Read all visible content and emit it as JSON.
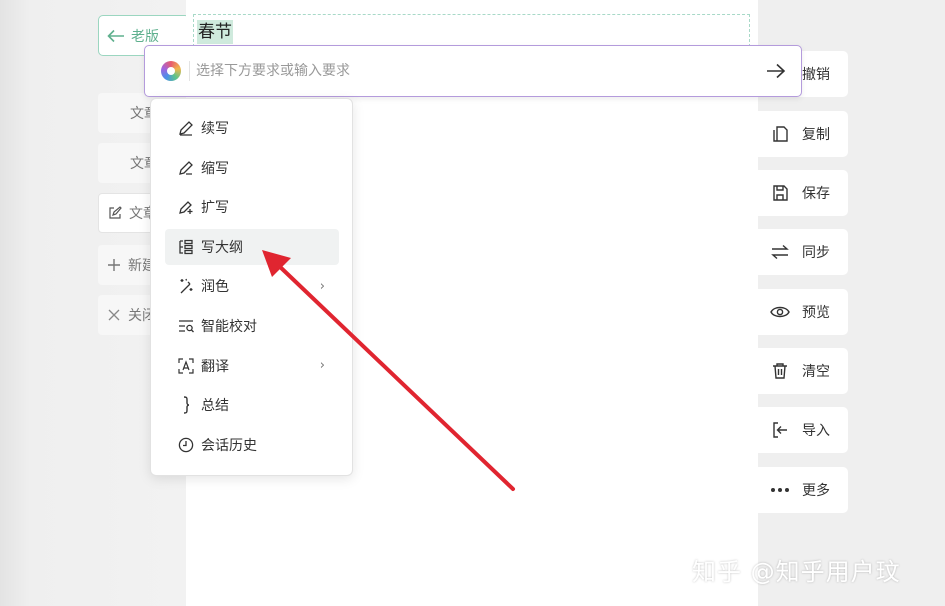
{
  "header": {
    "old_version_label": "老版"
  },
  "left_panel": {
    "items": [
      {
        "label": "文章"
      },
      {
        "label": "文章"
      },
      {
        "label": "文章"
      },
      {
        "label": "新建"
      },
      {
        "label": "关闭"
      }
    ]
  },
  "document": {
    "selected_text": "春节"
  },
  "ai_bar": {
    "placeholder": "选择下方要求或输入要求"
  },
  "menu": {
    "items": [
      {
        "label": "续写",
        "icon": "pen-icon"
      },
      {
        "label": "缩写",
        "icon": "pen-icon"
      },
      {
        "label": "扩写",
        "icon": "pen-plus-icon"
      },
      {
        "label": "写大纲",
        "icon": "outline-icon"
      },
      {
        "label": "润色",
        "icon": "magic-wand-icon",
        "submenu": "›"
      },
      {
        "label": "智能校对",
        "icon": "proofread-icon"
      },
      {
        "label": "翻译",
        "icon": "translate-icon",
        "submenu": "›"
      },
      {
        "label": "总结",
        "icon": "brace-icon"
      },
      {
        "label": "会话历史",
        "icon": "clock-icon"
      }
    ]
  },
  "toolbar": {
    "items": [
      {
        "label": "撤销",
        "icon": "undo-icon"
      },
      {
        "label": "复制",
        "icon": "copy-icon"
      },
      {
        "label": "保存",
        "icon": "save-icon"
      },
      {
        "label": "同步",
        "icon": "sync-icon"
      },
      {
        "label": "预览",
        "icon": "eye-icon"
      },
      {
        "label": "清空",
        "icon": "trash-icon"
      },
      {
        "label": "导入",
        "icon": "import-icon"
      },
      {
        "label": "更多",
        "icon": "more-icon"
      }
    ]
  },
  "watermark": "知乎 @知乎用户玟",
  "colors": {
    "accent": "#5fb08e",
    "ai_border": "#b49bdc",
    "annotation": "#e02530"
  }
}
